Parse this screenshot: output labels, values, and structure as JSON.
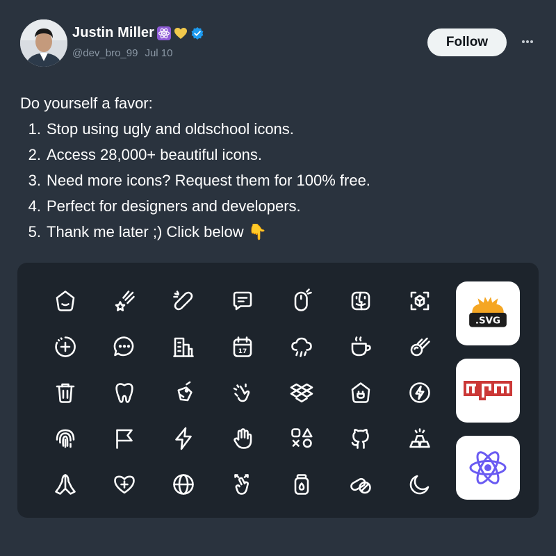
{
  "author": {
    "name": "Justin Miller",
    "handle": "@dev_bro_99",
    "date": "Jul 10",
    "badges": [
      "atom-emoji",
      "yellow-heart-emoji",
      "verified-badge"
    ]
  },
  "follow_label": "Follow",
  "tweet": {
    "intro": "Do yourself a favor:",
    "items": [
      {
        "num": "1.",
        "text": "Stop using ugly and oldschool icons."
      },
      {
        "num": "2.",
        "text": "Access 28,000+ beautiful icons."
      },
      {
        "num": "3.",
        "text": "Need more icons? Request them for 100% free."
      },
      {
        "num": "4.",
        "text": "Perfect for designers and developers."
      },
      {
        "num": "5.",
        "text": "Thank me later ;)  Click below 👇"
      }
    ]
  },
  "icons": [
    "home-icon",
    "comet-icon",
    "chain-link-icon",
    "message-icon",
    "mouse-icon",
    "finder-icon",
    "scan-cube-icon",
    "add-circle-icon",
    "chat-bubble-icon",
    "buildings-icon",
    "calendar-icon",
    "cloud-rain-icon",
    "coffee-cup-icon",
    "meteor-icon",
    "trash-icon",
    "tooth-icon",
    "tag-icon",
    "gesture-icon",
    "dropbox-icon",
    "home-plug-icon",
    "bolt-circle-icon",
    "fingerprint-icon",
    "flag-icon",
    "lightning-icon",
    "hand-icon",
    "shapes-icon",
    "github-icon",
    "gold-bars-icon",
    "praying-hands-icon",
    "heart-plus-icon",
    "globe-icon",
    "hand-pointer-icon",
    "jar-fire-icon",
    "pill-icon",
    "moon-icon"
  ],
  "tiles": {
    "svg_label": ".SVG",
    "npm_label": "npm",
    "react_icon": "react-atom-icon"
  },
  "colors": {
    "background": "#2a333e",
    "card": "#1d242c",
    "svg_orange": "#f5a623",
    "npm_red": "#cb3837",
    "react_purple": "#6a5bf2",
    "verified_blue": "#1d9bf0"
  }
}
